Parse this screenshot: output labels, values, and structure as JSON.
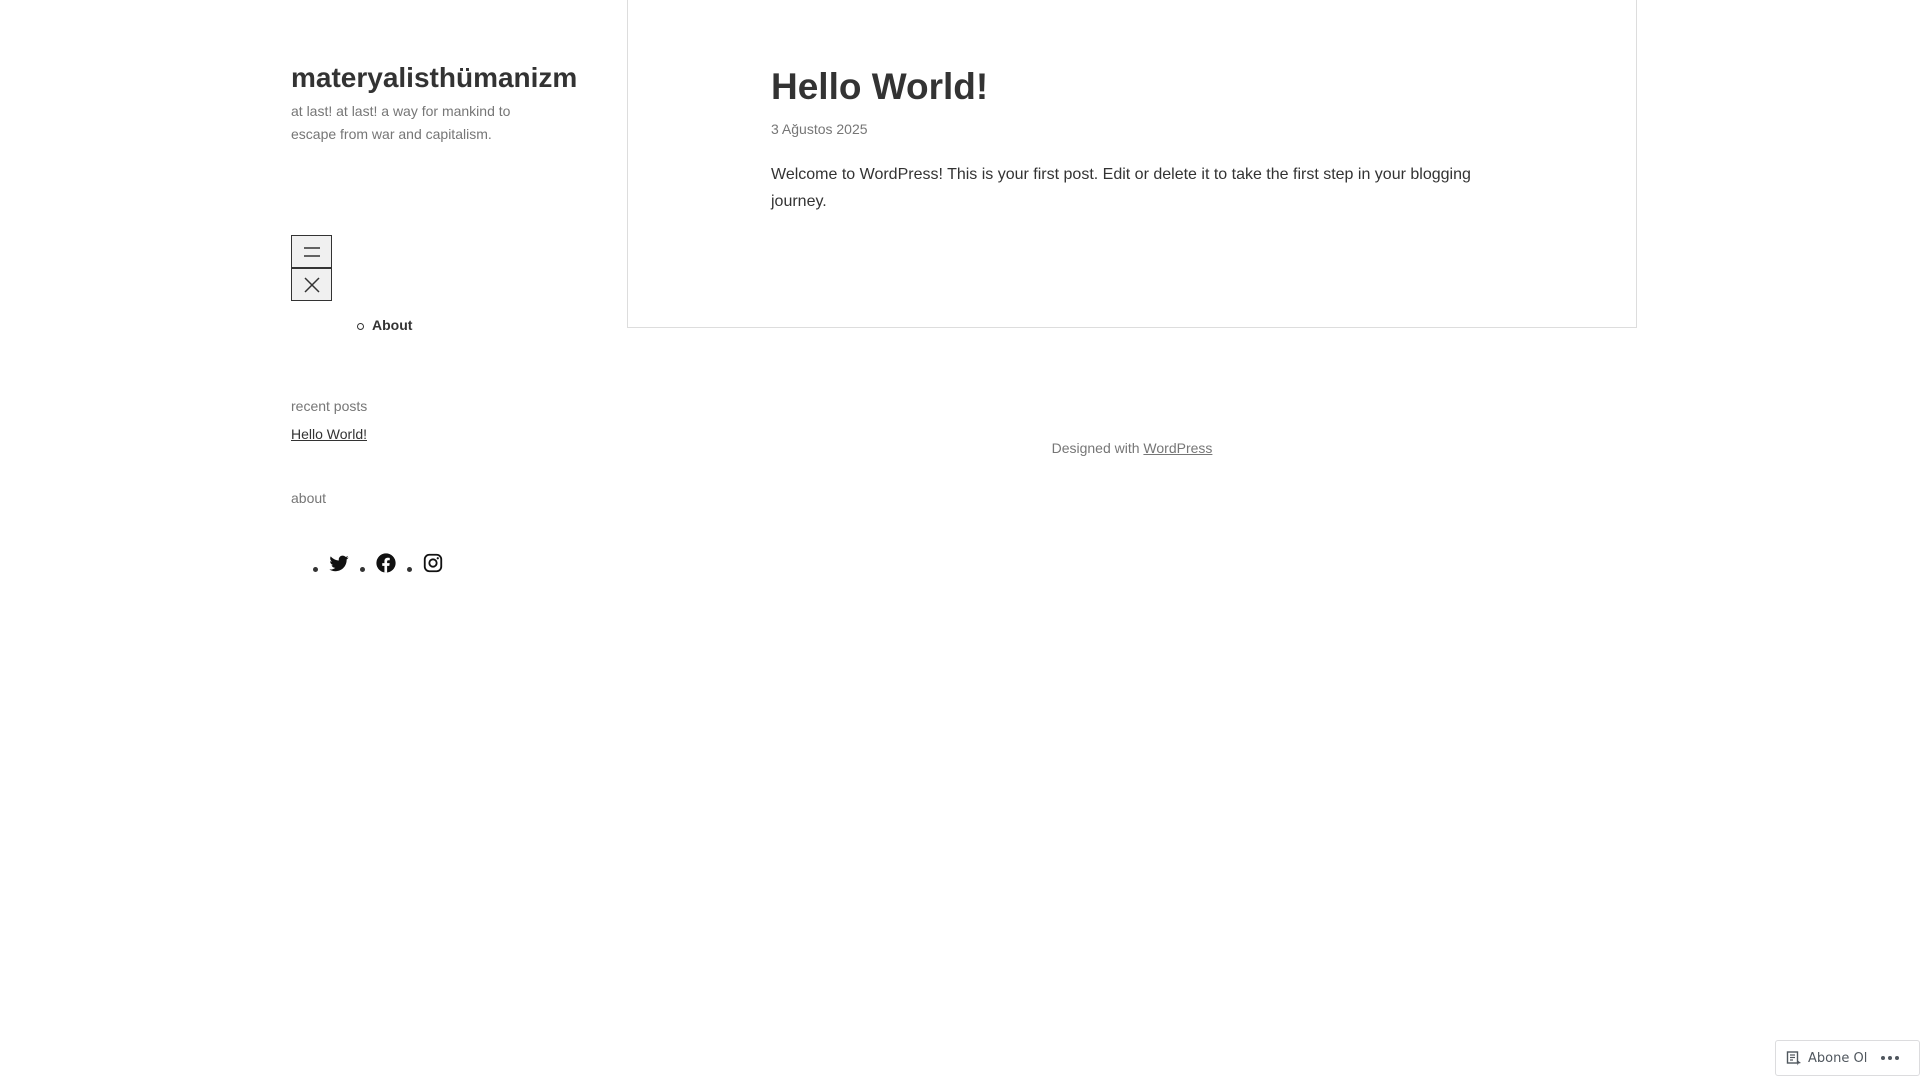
{
  "site": {
    "title": "materyalisthümanizm",
    "description": "at last! at last! a way for mankind to escape from war and capitalism."
  },
  "menu": {
    "open_icon": "hamburger-icon",
    "close_icon": "close-icon",
    "items": [
      {
        "label": "About"
      }
    ]
  },
  "widgets": {
    "recent_posts_title": "recent posts",
    "recent_posts": [
      {
        "label": "Hello World!"
      }
    ],
    "about_title": "about",
    "social": [
      {
        "icon": "twitter-icon"
      },
      {
        "icon": "facebook-icon"
      },
      {
        "icon": "instagram-icon"
      }
    ]
  },
  "post": {
    "title": "Hello World!",
    "date": "3 Ağustos 2025",
    "content": "Welcome to WordPress! This is your first post. Edit or delete it to take the first step in your blogging journey."
  },
  "footer": {
    "prefix": "Designed with ",
    "link": "WordPress"
  },
  "subscribe_bar": {
    "label": "Abone Ol",
    "icon": "reader-icon",
    "more_icon": "ellipsis-icon"
  },
  "colors": {
    "text": "#333333",
    "muted": "#767676",
    "border": "#dddddd"
  }
}
